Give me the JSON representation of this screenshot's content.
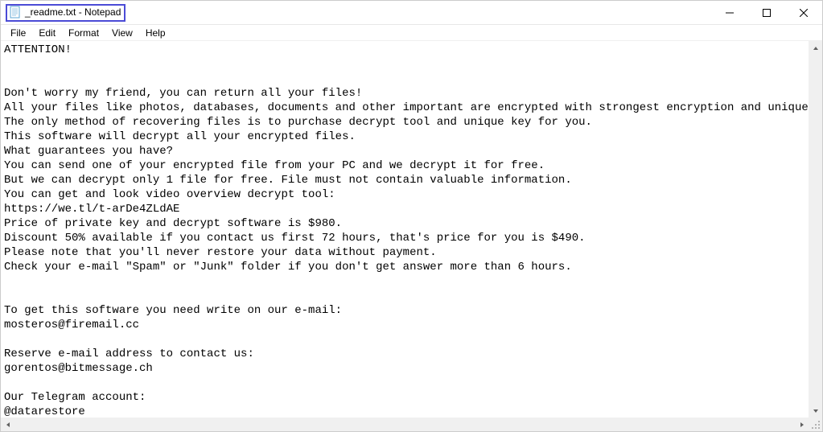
{
  "window": {
    "title": "_readme.txt - Notepad"
  },
  "menu": {
    "file": "File",
    "edit": "Edit",
    "format": "Format",
    "view": "View",
    "help": "Help"
  },
  "document": {
    "text": "ATTENTION!\n\n\nDon't worry my friend, you can return all your files!\nAll your files like photos, databases, documents and other important are encrypted with strongest encryption and unique key.\nThe only method of recovering files is to purchase decrypt tool and unique key for you.\nThis software will decrypt all your encrypted files.\nWhat guarantees you have?\nYou can send one of your encrypted file from your PC and we decrypt it for free.\nBut we can decrypt only 1 file for free. File must not contain valuable information.\nYou can get and look video overview decrypt tool:\nhttps://we.tl/t-arDe4ZLdAE\nPrice of private key and decrypt software is $980.\nDiscount 50% available if you contact us first 72 hours, that's price for you is $490.\nPlease note that you'll never restore your data without payment.\nCheck your e-mail \"Spam\" or \"Junk\" folder if you don't get answer more than 6 hours.\n\n\nTo get this software you need write on our e-mail:\nmosteros@firemail.cc\n\nReserve e-mail address to contact us:\ngorentos@bitmessage.ch\n\nOur Telegram account:\n@datarestore"
  }
}
